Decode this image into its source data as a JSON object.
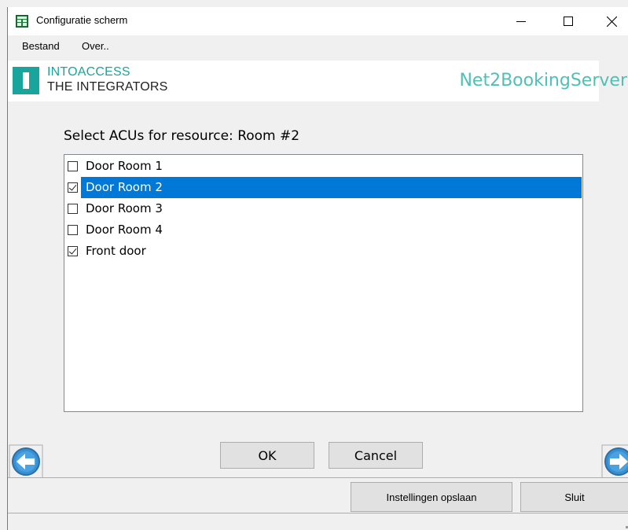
{
  "window": {
    "title": "Configuratie scherm"
  },
  "menu": {
    "items": [
      "Bestand",
      "Over.."
    ]
  },
  "header": {
    "logo_line1": "INTOACCESS",
    "logo_line2": "THE INTEGRATORS",
    "product_name": "Net2BookingServer",
    "accent_color": "#1aa59c"
  },
  "content": {
    "prompt": "Select ACUs for resource: Room #2",
    "acus": [
      {
        "label": "Door Room 1",
        "checked": false,
        "selected": false
      },
      {
        "label": "Door Room 2",
        "checked": true,
        "selected": true
      },
      {
        "label": "Door Room 3",
        "checked": false,
        "selected": false
      },
      {
        "label": "Door Room 4",
        "checked": false,
        "selected": false
      },
      {
        "label": "Front door",
        "checked": true,
        "selected": false
      }
    ]
  },
  "buttons": {
    "ok": "OK",
    "cancel": "Cancel",
    "save_settings": "Instellingen opslaan",
    "close": "Sluit"
  },
  "icons": {
    "app": "grid-app-icon",
    "prev": "arrow-left-circle-icon",
    "next": "arrow-right-circle-icon"
  }
}
